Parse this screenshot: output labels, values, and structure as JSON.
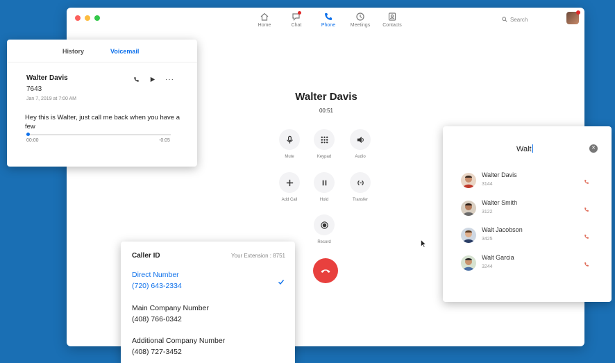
{
  "nav": {
    "items": [
      {
        "label": "Home",
        "icon": "home-icon"
      },
      {
        "label": "Chat",
        "icon": "chat-icon"
      },
      {
        "label": "Phone",
        "icon": "phone-icon"
      },
      {
        "label": "Meetings",
        "icon": "clock-icon"
      },
      {
        "label": "Contacts",
        "icon": "contacts-icon"
      }
    ],
    "active": "Phone"
  },
  "search": {
    "placeholder": "Search"
  },
  "call": {
    "name": "Walter Davis",
    "timer": "00:51",
    "controls": [
      {
        "label": "Mute",
        "icon": "microphone-icon"
      },
      {
        "label": "Keypad",
        "icon": "keypad-icon"
      },
      {
        "label": "Audio",
        "icon": "speaker-icon"
      },
      {
        "label": "Add Call",
        "icon": "plus-icon"
      },
      {
        "label": "Hold",
        "icon": "pause-icon"
      },
      {
        "label": "Transfer",
        "icon": "transfer-icon"
      },
      {
        "label": "Record",
        "icon": "record-icon"
      }
    ],
    "hangup_color": "#e8403e"
  },
  "voicemail": {
    "tabs": {
      "history": "History",
      "voicemail": "Voicemail"
    },
    "entry": {
      "name": "Walter Davis",
      "number": "7643",
      "date": "Jan 7, 2019 at 7:00 AM",
      "message": "Hey this is Walter, just call me back when you have a few",
      "time_start": "00:00",
      "time_end": "-0:05",
      "progress": 0.01
    }
  },
  "contact_search": {
    "query": "Walt",
    "results": [
      {
        "name": "Walter Davis",
        "ext": "3144"
      },
      {
        "name": "Walter Smith",
        "ext": "3122"
      },
      {
        "name": "Walt Jacobson",
        "ext": "3425"
      },
      {
        "name": "Walt Garcia",
        "ext": "3244"
      }
    ]
  },
  "caller_id": {
    "title": "Caller ID",
    "extension": "Your Extension : 8751",
    "options": [
      {
        "label": "Direct Number",
        "number": "(720) 643-2334",
        "selected": true
      },
      {
        "label": "Main Company Number",
        "number": "(408) 766-0342",
        "selected": false
      },
      {
        "label": "Additional Company Number",
        "number": "(408) 727-3452",
        "selected": false
      }
    ]
  },
  "colors": {
    "accent": "#0e71eb",
    "background": "#1a6fb4",
    "hangup": "#e8403e"
  }
}
